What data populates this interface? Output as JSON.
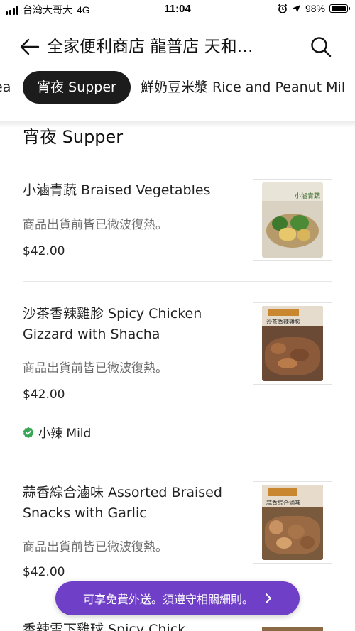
{
  "status_bar": {
    "carrier": "台湾大哥大",
    "network": "4G",
    "time": "11:04",
    "battery": "98%"
  },
  "header": {
    "title": "全家便利商店 龍普店 天和…",
    "back_icon": "arrow-left-icon",
    "search_icon": "search-icon"
  },
  "tabs": [
    {
      "label": "ea",
      "active": false
    },
    {
      "label": "宵夜 Supper",
      "active": true
    },
    {
      "label": "鮮奶豆米漿 Rice and Peanut Mil",
      "active": false
    }
  ],
  "section": {
    "title": "宵夜 Supper"
  },
  "items": [
    {
      "name": "小滷青蔬 Braised Vegetables",
      "description": "商品出貨前皆已微波復熱。",
      "price": "$42.00",
      "thumb_label": "小滷青蔬"
    },
    {
      "name": "沙茶香辣雞胗 Spicy Chicken Gizzard with Shacha",
      "description": "商品出貨前皆已微波復熱。",
      "price": "$42.00",
      "badge": "小辣 Mild",
      "thumb_label": "沙茶香辣雞胗"
    },
    {
      "name": "蒜香綜合滷味 Assorted Braised Snacks with Garlic",
      "description": "商品出貨前皆已微波復熱。",
      "price": "$42.00",
      "thumb_label": "蒜香綜合滷味"
    }
  ],
  "cutoff_item": {
    "name": "香辣雪下雞球 Spicy Chick"
  },
  "promo": {
    "text": "可享免費外送。須遵守相關細則。",
    "chevron_icon": "chevron-right-icon"
  },
  "colors": {
    "accent": "#6f3fc7",
    "active_tab": "#1c1c1c",
    "badge_check": "#3aa757"
  }
}
